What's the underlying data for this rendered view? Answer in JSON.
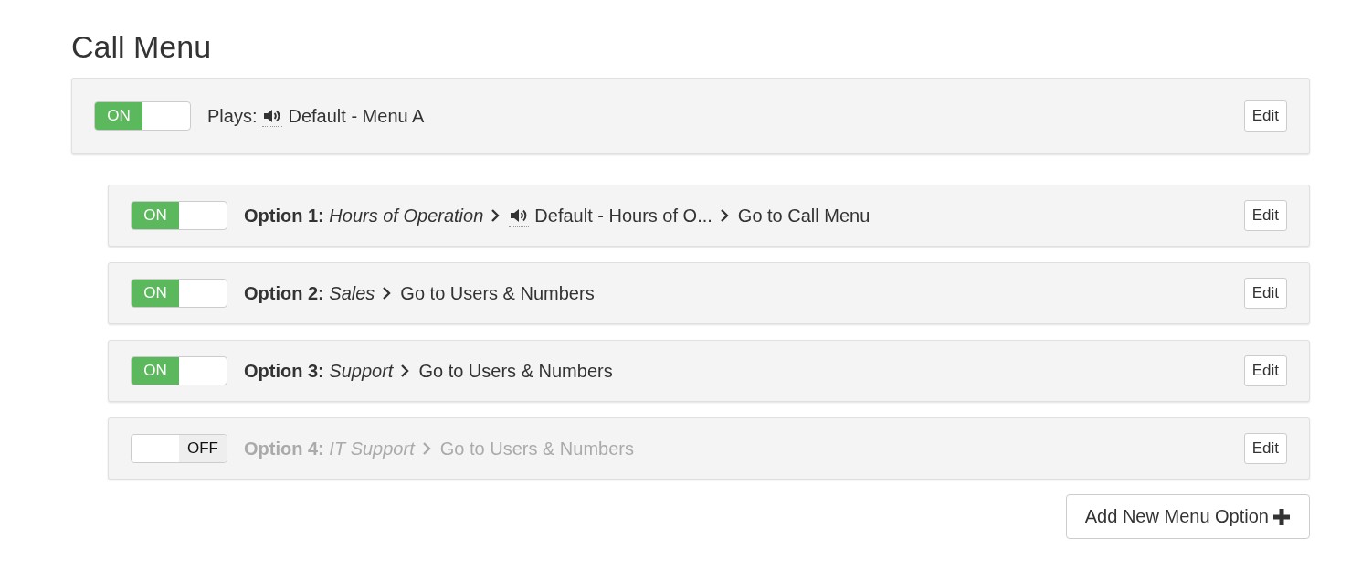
{
  "title": "Call Menu",
  "main": {
    "on": true,
    "toggle_label": "ON",
    "plays_label": "Plays:",
    "audio": "Default - Menu A",
    "edit": "Edit"
  },
  "options": [
    {
      "on": true,
      "toggle_label": "ON",
      "label": "Option 1:",
      "name": "Hours of Operation",
      "steps": [
        {
          "kind": "audio",
          "text": "Default - Hours of O..."
        },
        {
          "kind": "action",
          "text": "Go to Call Menu"
        }
      ],
      "edit": "Edit"
    },
    {
      "on": true,
      "toggle_label": "ON",
      "label": "Option 2:",
      "name": "Sales",
      "steps": [
        {
          "kind": "action",
          "text": "Go to Users & Numbers"
        }
      ],
      "edit": "Edit"
    },
    {
      "on": true,
      "toggle_label": "ON",
      "label": "Option 3:",
      "name": "Support",
      "steps": [
        {
          "kind": "action",
          "text": "Go to Users & Numbers"
        }
      ],
      "edit": "Edit"
    },
    {
      "on": false,
      "toggle_label": "OFF",
      "label": "Option 4:",
      "name": "IT Support",
      "steps": [
        {
          "kind": "action",
          "text": "Go to Users & Numbers"
        }
      ],
      "edit": "Edit"
    }
  ],
  "add_button": "Add New Menu Option"
}
